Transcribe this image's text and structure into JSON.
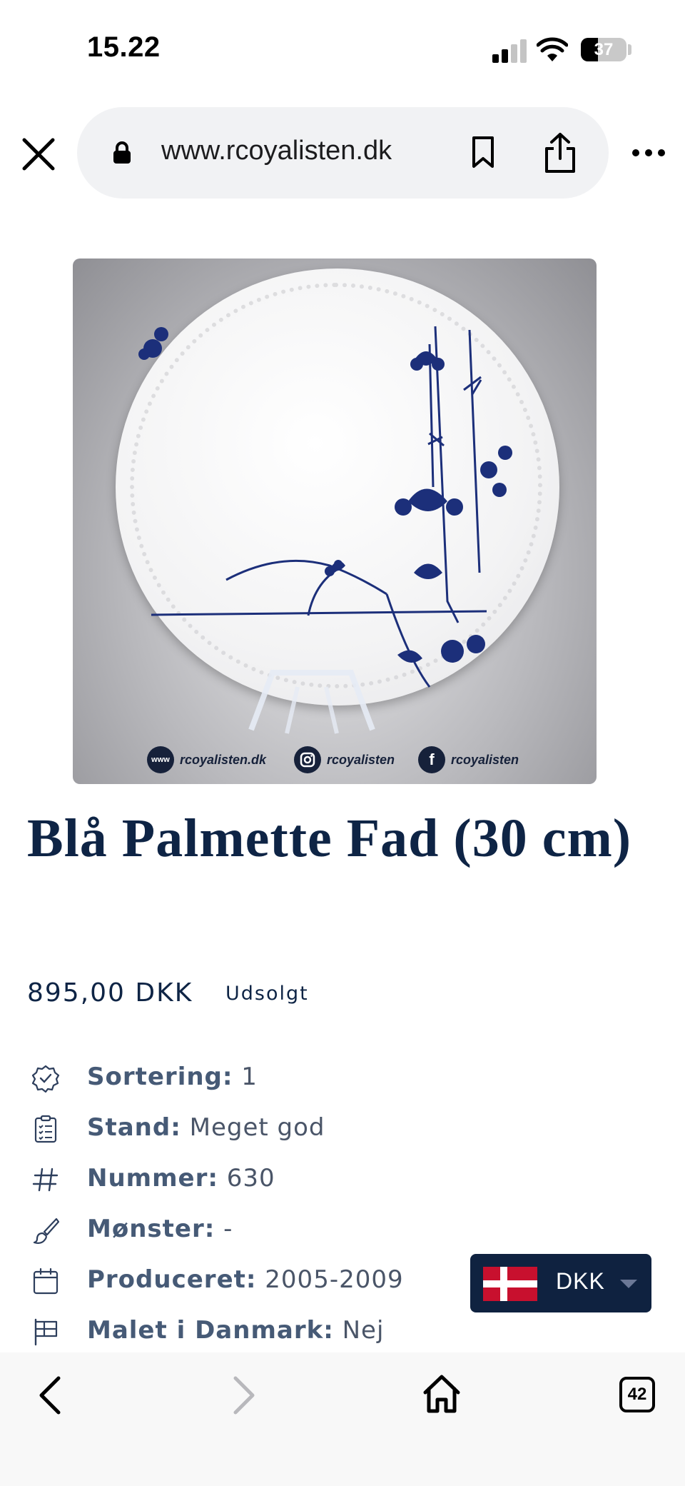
{
  "status_bar": {
    "time": "15.22",
    "battery": "37",
    "battery_level": 0.37
  },
  "browser": {
    "url": "www.rcoyalisten.dk",
    "icons": {
      "close": "close-icon",
      "lock": "lock-icon",
      "bookmark": "bookmark-icon",
      "share": "share-icon",
      "more": "more-icon"
    }
  },
  "product_image": {
    "watermark": {
      "web_badge": "www",
      "web": "rcoyalisten.dk",
      "instagram": "rcoyalisten",
      "facebook_badge": "f",
      "facebook": "rcoyalisten"
    }
  },
  "product": {
    "title": "Blå Palmette Fad (30 cm)",
    "price": "895,00 DKK",
    "stock_status": "Udsolgt",
    "attributes": [
      {
        "icon": "badge-check-icon",
        "label": "Sortering:",
        "value": " 1"
      },
      {
        "icon": "clipboard-list-icon",
        "label": "Stand:",
        "value": " Meget god"
      },
      {
        "icon": "hash-icon",
        "label": "Nummer:",
        "value": " 630"
      },
      {
        "icon": "brush-icon",
        "label": "Mønster:",
        "value": " -"
      },
      {
        "icon": "calendar-icon",
        "label": "Produceret:",
        "value": " 2005-2009"
      },
      {
        "icon": "flag-icon",
        "label": "Malet i Danmark:",
        "value": " Nej"
      }
    ]
  },
  "currency_selector": {
    "code": "DKK",
    "flag": "denmark-flag"
  },
  "bottom_nav": {
    "tab_count": "42",
    "icons": {
      "back": "back-icon",
      "forward": "forward-icon",
      "home": "home-icon",
      "tabs": "tabs-icon"
    }
  },
  "colors": {
    "primary_navy": "#0f2240",
    "text_gray": "#4a5568",
    "flag_red": "#c8102e"
  }
}
